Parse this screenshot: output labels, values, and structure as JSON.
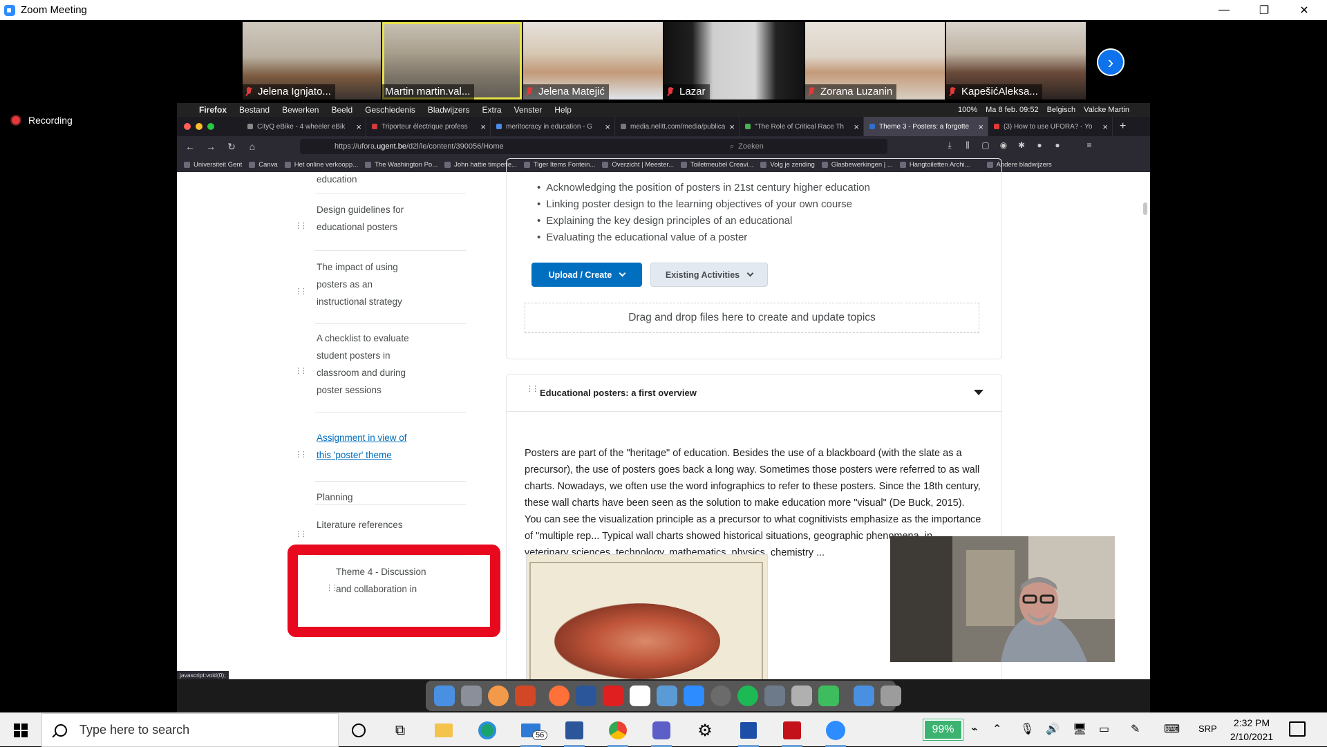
{
  "zoom": {
    "window_title": "Zoom Meeting",
    "window_controls": {
      "minimize": "—",
      "restore": "❐",
      "close": "✕"
    },
    "recording_label": "Recording",
    "participants": [
      {
        "name": "Jelena Ignjato...",
        "muted": true
      },
      {
        "name": "Martin martin.val...",
        "muted": false,
        "active_speaker": true
      },
      {
        "name": "Jelena Matejić",
        "muted": true
      },
      {
        "name": "Lazar",
        "muted": true
      },
      {
        "name": "Zorana Luzanin",
        "muted": true
      },
      {
        "name": "KapešićAleksa...",
        "muted": true
      }
    ],
    "next_page_icon": "chevron-right-icon"
  },
  "mac": {
    "menubar": {
      "apple": "",
      "app": "Firefox",
      "menus": [
        "Bestand",
        "Bewerken",
        "Beeld",
        "Geschiedenis",
        "Bladwijzers",
        "Extra",
        "Venster",
        "Help"
      ],
      "battery": "100%",
      "datetime": "Ma 8 feb.  09:52",
      "lang": "Belgisch",
      "user": "Valcke Martin"
    }
  },
  "browser": {
    "tabs": [
      {
        "label": "CityQ eBike - 4 wheeler eBik",
        "color": "#888888"
      },
      {
        "label": "Triporteur électrique profess",
        "color": "#d23b3b"
      },
      {
        "label": "meritocracy in education - G",
        "color": "#4a8ae8"
      },
      {
        "label": "media.nelitt.com/media/publicati",
        "color": "#777777"
      },
      {
        "label": "\"The Role of Critical Race Th",
        "color": "#4caf50"
      },
      {
        "label": "Theme 3 - Posters: a forgotte",
        "color": "#2f6fd0",
        "active": true
      },
      {
        "label": "(3) How to use UFORA? - Yo",
        "color": "#e53935"
      }
    ],
    "url_prefix": "https://ufora.",
    "url_host": "ugent.be",
    "url_rest": "/d2l/le/content/390056/Home",
    "search_placeholder": "Zoeken",
    "bookmarks": [
      "Universiteit Gent",
      "Canva",
      "Het online verkoopp...",
      "The Washington Po...",
      "John hattie timperle...",
      "Tiger Items Fontein...",
      "Overzicht | Meester...",
      "Toiletmeubel Creavi...",
      "Volg je zending",
      "Glasbewerkingen | ...",
      "Hangtoiletten Archi...",
      "Andere bladwijzers"
    ],
    "status_url": "javascript:void(0);"
  },
  "toc": {
    "items": [
      {
        "label": "education"
      },
      {
        "label": "Design guidelines for educational posters"
      },
      {
        "label": "The impact of using posters as an instructional strategy"
      },
      {
        "label": "A checklist to evaluate student posters in classroom and during poster sessions"
      },
      {
        "label": "Assignment in view of this 'poster' theme",
        "link": true
      },
      {
        "label": "Planning"
      },
      {
        "label": "Literature references"
      }
    ],
    "next_theme": "Theme 4 - Discussion and collaboration in"
  },
  "main": {
    "objectives": [
      "Acknowledging the position of posters in 21st century higher education",
      "Linking poster design to the learning objectives of your own course",
      "Explaining the key design principles of an educational",
      "Evaluating the educational value of a poster"
    ],
    "upload_label": "Upload / Create",
    "existing_label": "Existing Activities",
    "dropzone_label": "Drag and drop files here to create and update topics",
    "topic_title": "Educational posters: a first overview",
    "topic_body": "Posters are part of the \"heritage\" of education. Besides the use of a blackboard (with the slate as a precursor), the use of posters goes back a long way. Sometimes those posters were referred to as wall charts. Nowadays, we often use the word infographics to refer to these posters. Since the 18th century, these wall charts have been seen as the solution to make education more \"visual\" (De Buck, 2015). You can see the visualization principle as a precursor to what cognitivists emphasize as the importance of \"multiple rep... Typical wall charts showed historical situations, geographic phenomena, in... veterinary sciences, technology, mathematics, physics, chemistry ..."
  },
  "taskbar": {
    "search_placeholder": "Type here to search",
    "mail_badge": "56",
    "battery": "99%",
    "lang": "SRP",
    "time": "2:32 PM",
    "date": "2/10/2021",
    "apps": [
      "task-view",
      "timeline",
      "file-explorer",
      "edge",
      "mail",
      "word",
      "chrome",
      "teams",
      "settings",
      "save",
      "acrobat",
      "zoom"
    ]
  }
}
